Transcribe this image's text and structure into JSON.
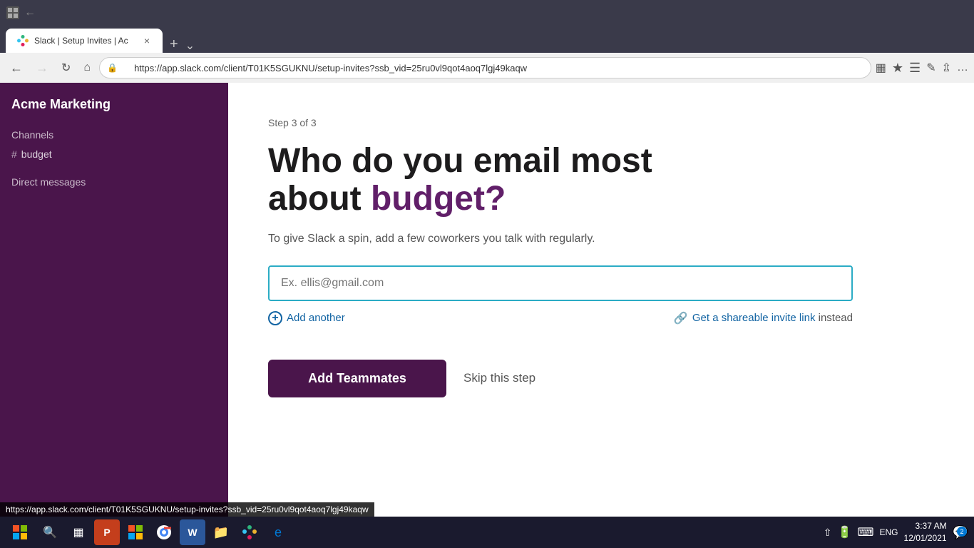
{
  "browser": {
    "tab_title": "Slack | Setup Invites | Ac",
    "tab_close": "×",
    "new_tab": "+",
    "url": "https://app.slack.com/client/T01K5SGUKNU/setup-invites?ssb_vid=25ru0vl9qot4aoq7lgj49kaqw",
    "status_url": "https://app.slack.com/client/T01K5SGUKNU/setup-invites?ssb_vid=25ru0vl9qot4aoq7lgj49kaqw"
  },
  "sidebar": {
    "workspace_name": "Acme Marketing",
    "channels_label": "Channels",
    "channel_name": "budget",
    "dm_label": "Direct messages"
  },
  "main": {
    "step_indicator": "Step 3 of 3",
    "heading_part1": "Who do you email most",
    "heading_part2": "about ",
    "heading_highlight": "budget?",
    "sub_text": "To give Slack a spin, add a few coworkers you talk with regularly.",
    "email_placeholder": "Ex. ellis@gmail.com",
    "add_another_label": "Add another",
    "invite_link_label": "Get a shareable invite link",
    "invite_link_suffix": " instead",
    "add_teammates_btn": "Add Teammates",
    "skip_btn": "Skip this step"
  },
  "taskbar": {
    "time": "3:37 AM",
    "date": "12/01/2021",
    "language": "ENG"
  }
}
